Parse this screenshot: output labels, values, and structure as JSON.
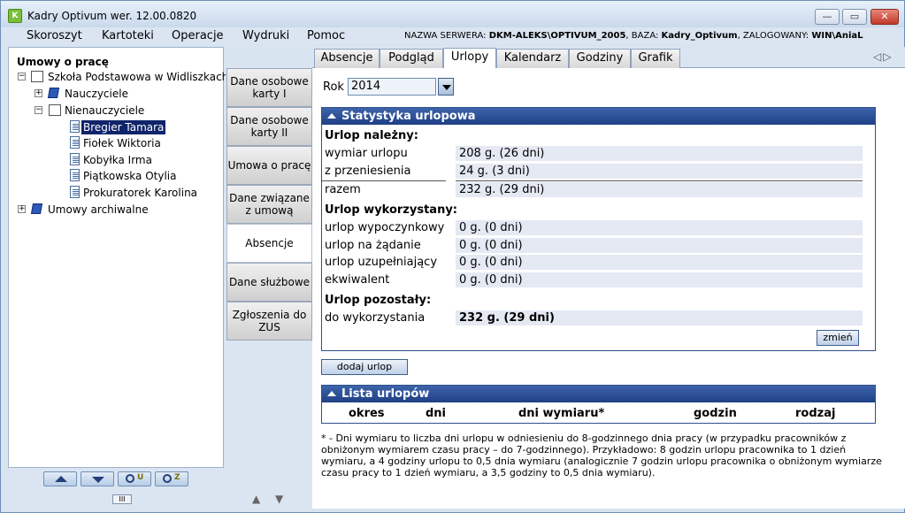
{
  "window": {
    "title": "Kadry Optivum wer. 12.00.0820",
    "icon_label": "K"
  },
  "menu": {
    "items": [
      "Skoroszyt",
      "Kartoteki",
      "Operacje",
      "Wydruki",
      "Pomoc"
    ]
  },
  "server_info": {
    "server_label": "NAZWA SERWERA: ",
    "server_value": "DKM-ALEKS\\OPTIVUM_2005",
    "db_label": ", BAZA: ",
    "db_value": "Kadry_Optivum",
    "user_label": ", ZALOGOWANY: ",
    "user_value": "WIN\\AniaL"
  },
  "tree": {
    "heading": "Umowy o pracę",
    "school": "Szkoła Podstawowa w Widliszkach",
    "group1": "Nauczyciele",
    "group2": "Nienauczyciele",
    "people": [
      "Bregier Tamara",
      "Fiołek Wiktoria",
      "Kobyłka Irma",
      "Piątkowska Otylia",
      "Prokuratorek Karolina"
    ],
    "archive": "Umowy archiwalne"
  },
  "left_footer": {
    "search1_letter": "U",
    "search2_letter": "Z",
    "grip": "III"
  },
  "vertical_tabs": [
    {
      "label": "Dane osobowe karty I"
    },
    {
      "label": "Dane osobowe karty II"
    },
    {
      "label": "Umowa o pracę"
    },
    {
      "label": "Dane związane z umową"
    },
    {
      "label": "Absencje"
    },
    {
      "label": "Dane służbowe"
    },
    {
      "label": "Zgłoszenia do ZUS"
    }
  ],
  "vertical_nav": {
    "up": "▲",
    "down": "▼"
  },
  "tabs": [
    "Absencje",
    "Podgląd",
    "Urlopy",
    "Kalendarz",
    "Godziny",
    "Grafik"
  ],
  "active_tab": "Urlopy",
  "year": {
    "label": "Rok",
    "value": "2014"
  },
  "stats": {
    "title": "Statystyka urlopowa",
    "due_title": "Urlop należny:",
    "due": [
      {
        "label": "wymiar urlopu",
        "value": "208 g. (26 dni)"
      },
      {
        "label": "z przeniesienia",
        "value": "24 g. (3 dni)"
      },
      {
        "label": "razem",
        "value": "232 g. (29 dni)"
      }
    ],
    "used_title": "Urlop wykorzystany:",
    "used": [
      {
        "label": "urlop wypoczynkowy",
        "value": "0 g. (0 dni)"
      },
      {
        "label": "urlop na żądanie",
        "value": "0 g. (0 dni)"
      },
      {
        "label": "urlop uzupełniający",
        "value": "0 g. (0 dni)"
      },
      {
        "label": "ekwiwalent",
        "value": "0 g. (0 dni)"
      }
    ],
    "left_title": "Urlop pozostały:",
    "left": {
      "label": "do wykorzystania",
      "value": "232 g. (29 dni)"
    },
    "change_button": "zmień"
  },
  "add_button": "dodaj urlop",
  "list": {
    "title": "Lista urlopów",
    "columns": [
      "okres",
      "dni",
      "dni wymiaru*",
      "godzin",
      "rodzaj"
    ]
  },
  "footnote": "* - Dni wymiaru to liczba dni urlopu w odniesieniu do 8-godzinnego dnia pracy (w przypadku pracowników z obniżonym wymiarem czasu pracy – do 7-godzinnego). Przykładowo: 8 godzin urlopu pracownika to 1 dzień wymiaru, a 4 godziny urlopu to 0,5 dnia wymiaru (analogicznie 7 godzin urlopu pracownika o obniżonym wymiarze czasu pracy to 1 dzień wymiaru, a 3,5 godziny to 0,5 dnia wymiaru).",
  "colors": {
    "panel_header": "#1f3f86",
    "selected_bg": "#10246a",
    "value_bg": "#e4e9f3"
  }
}
